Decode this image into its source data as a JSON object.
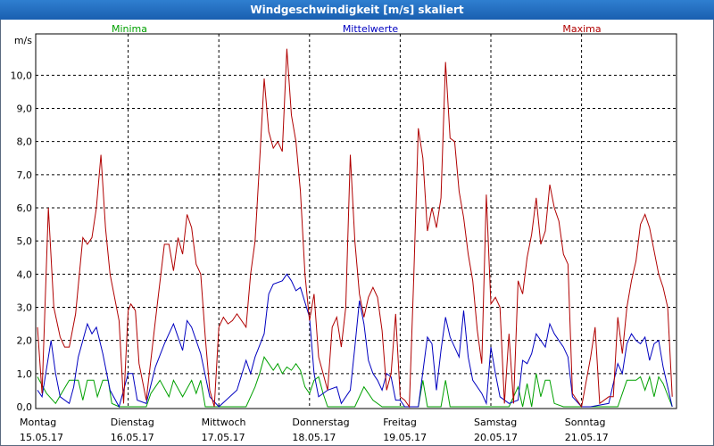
{
  "window": {
    "title": "Windgeschwindigkeit [m/s] skaliert"
  },
  "chart_data": {
    "type": "line",
    "title": "Windgeschwindigkeit [m/s] skaliert",
    "ylabel": "m/s",
    "ylim": [
      0,
      11.3
    ],
    "yticks": [
      "0,0",
      "1,0",
      "2,0",
      "3,0",
      "4,0",
      "5,0",
      "6,0",
      "7,0",
      "8,0",
      "9,0",
      "10,0"
    ],
    "grid": true,
    "legend_position": "top",
    "x_days": [
      {
        "day": "Montag",
        "date": "15.05.17"
      },
      {
        "day": "Dienstag",
        "date": "16.05.17"
      },
      {
        "day": "Mittwoch",
        "date": "17.05.17"
      },
      {
        "day": "Donnerstag",
        "date": "18.05.17"
      },
      {
        "day": "Freitag",
        "date": "19.05.17"
      },
      {
        "day": "Samstag",
        "date": "20.05.17"
      },
      {
        "day": "Sonntag",
        "date": "21.05.17"
      }
    ],
    "xlim_days": [
      0,
      7
    ],
    "series": [
      {
        "name": "Minima",
        "color": "#00a000",
        "points": [
          [
            0,
            0.9
          ],
          [
            0.1,
            0.4
          ],
          [
            0.2,
            0.1
          ],
          [
            0.35,
            0.8
          ],
          [
            0.45,
            0.8
          ],
          [
            0.5,
            0.2
          ],
          [
            0.55,
            0.8
          ],
          [
            0.62,
            0.8
          ],
          [
            0.66,
            0.3
          ],
          [
            0.72,
            0.8
          ],
          [
            0.78,
            0.8
          ],
          [
            0.82,
            0.1
          ],
          [
            0.9,
            0
          ],
          [
            1,
            0
          ],
          [
            1.2,
            0
          ],
          [
            1.25,
            0.4
          ],
          [
            1.35,
            0.8
          ],
          [
            1.45,
            0.3
          ],
          [
            1.5,
            0.8
          ],
          [
            1.6,
            0.3
          ],
          [
            1.7,
            0.8
          ],
          [
            1.75,
            0.4
          ],
          [
            1.8,
            0.8
          ],
          [
            1.85,
            0
          ],
          [
            2,
            0
          ],
          [
            2.3,
            0
          ],
          [
            2.4,
            0.6
          ],
          [
            2.45,
            1.0
          ],
          [
            2.5,
            1.5
          ],
          [
            2.55,
            1.3
          ],
          [
            2.6,
            1.1
          ],
          [
            2.65,
            1.3
          ],
          [
            2.7,
            1.0
          ],
          [
            2.75,
            1.2
          ],
          [
            2.8,
            1.1
          ],
          [
            2.85,
            1.3
          ],
          [
            2.9,
            1.1
          ],
          [
            2.95,
            0.6
          ],
          [
            3.0,
            0.4
          ],
          [
            3.05,
            0.8
          ],
          [
            3.1,
            0.9
          ],
          [
            3.15,
            0.4
          ],
          [
            3.2,
            0
          ],
          [
            3.3,
            0
          ],
          [
            3.5,
            0
          ],
          [
            3.6,
            0.6
          ],
          [
            3.7,
            0.2
          ],
          [
            3.8,
            0
          ],
          [
            4.0,
            0
          ],
          [
            4.2,
            0
          ],
          [
            4.25,
            0.8
          ],
          [
            4.3,
            0
          ],
          [
            4.45,
            0
          ],
          [
            4.5,
            0.8
          ],
          [
            4.55,
            0
          ],
          [
            4.7,
            0
          ],
          [
            5,
            0
          ],
          [
            5.2,
            0
          ],
          [
            5.3,
            0.6
          ],
          [
            5.35,
            0
          ],
          [
            5.4,
            0.7
          ],
          [
            5.45,
            0
          ],
          [
            5.5,
            1.0
          ],
          [
            5.55,
            0.3
          ],
          [
            5.6,
            0.8
          ],
          [
            5.65,
            0.8
          ],
          [
            5.7,
            0.1
          ],
          [
            5.8,
            0
          ],
          [
            6,
            0
          ],
          [
            6.4,
            0
          ],
          [
            6.5,
            0.8
          ],
          [
            6.55,
            0.8
          ],
          [
            6.6,
            0.8
          ],
          [
            6.65,
            0.9
          ],
          [
            6.7,
            0.5
          ],
          [
            6.75,
            0.9
          ],
          [
            6.8,
            0.3
          ],
          [
            6.85,
            0.9
          ],
          [
            6.9,
            0.7
          ],
          [
            7.0,
            0
          ]
        ]
      },
      {
        "name": "Mittelwerte",
        "color": "#0000c0",
        "points": [
          [
            0,
            0.5
          ],
          [
            0.05,
            0.3
          ],
          [
            0.15,
            2.0
          ],
          [
            0.2,
            1.0
          ],
          [
            0.25,
            0.3
          ],
          [
            0.35,
            0.1
          ],
          [
            0.4,
            0.6
          ],
          [
            0.45,
            1.5
          ],
          [
            0.5,
            2.0
          ],
          [
            0.55,
            2.5
          ],
          [
            0.6,
            2.2
          ],
          [
            0.65,
            2.4
          ],
          [
            0.72,
            1.6
          ],
          [
            0.8,
            0.5
          ],
          [
            0.9,
            0
          ],
          [
            1.0,
            1.0
          ],
          [
            1.05,
            1.0
          ],
          [
            1.1,
            0.2
          ],
          [
            1.2,
            0.1
          ],
          [
            1.3,
            1.2
          ],
          [
            1.4,
            1.9
          ],
          [
            1.5,
            2.5
          ],
          [
            1.55,
            2.1
          ],
          [
            1.6,
            1.7
          ],
          [
            1.65,
            2.6
          ],
          [
            1.7,
            2.4
          ],
          [
            1.8,
            1.6
          ],
          [
            1.9,
            0.3
          ],
          [
            2.0,
            0
          ],
          [
            2.2,
            0.5
          ],
          [
            2.3,
            1.4
          ],
          [
            2.35,
            1.0
          ],
          [
            2.4,
            1.5
          ],
          [
            2.5,
            2.2
          ],
          [
            2.55,
            3.4
          ],
          [
            2.6,
            3.7
          ],
          [
            2.7,
            3.8
          ],
          [
            2.75,
            4.0
          ],
          [
            2.8,
            3.8
          ],
          [
            2.85,
            3.5
          ],
          [
            2.9,
            3.6
          ],
          [
            3.0,
            2.7
          ],
          [
            3.05,
            1.0
          ],
          [
            3.1,
            0.3
          ],
          [
            3.2,
            0.5
          ],
          [
            3.3,
            0.6
          ],
          [
            3.35,
            0.1
          ],
          [
            3.45,
            0.5
          ],
          [
            3.5,
            1.8
          ],
          [
            3.55,
            3.2
          ],
          [
            3.6,
            2.5
          ],
          [
            3.65,
            1.4
          ],
          [
            3.7,
            1.0
          ],
          [
            3.75,
            0.8
          ],
          [
            3.8,
            0.5
          ],
          [
            3.85,
            1.0
          ],
          [
            3.9,
            0.9
          ],
          [
            3.95,
            0.2
          ],
          [
            4.0,
            0.2
          ],
          [
            4.05,
            0
          ],
          [
            4.2,
            0
          ],
          [
            4.3,
            2.1
          ],
          [
            4.35,
            1.9
          ],
          [
            4.4,
            0.5
          ],
          [
            4.45,
            1.7
          ],
          [
            4.5,
            2.7
          ],
          [
            4.55,
            2.1
          ],
          [
            4.65,
            1.5
          ],
          [
            4.7,
            2.9
          ],
          [
            4.75,
            1.5
          ],
          [
            4.8,
            0.8
          ],
          [
            4.9,
            0.4
          ],
          [
            4.95,
            0.1
          ],
          [
            5.0,
            1.8
          ],
          [
            5.05,
            1.0
          ],
          [
            5.1,
            0.3
          ],
          [
            5.2,
            0.1
          ],
          [
            5.3,
            0.2
          ],
          [
            5.35,
            1.4
          ],
          [
            5.4,
            1.3
          ],
          [
            5.45,
            1.6
          ],
          [
            5.5,
            2.2
          ],
          [
            5.6,
            1.8
          ],
          [
            5.65,
            2.5
          ],
          [
            5.7,
            2.2
          ],
          [
            5.75,
            2.0
          ],
          [
            5.8,
            1.8
          ],
          [
            5.85,
            1.5
          ],
          [
            5.9,
            0.3
          ],
          [
            6.0,
            0
          ],
          [
            6.1,
            0
          ],
          [
            6.3,
            0.1
          ],
          [
            6.4,
            1.3
          ],
          [
            6.45,
            1.0
          ],
          [
            6.5,
            1.9
          ],
          [
            6.55,
            2.2
          ],
          [
            6.6,
            2.0
          ],
          [
            6.65,
            1.9
          ],
          [
            6.7,
            2.1
          ],
          [
            6.75,
            1.4
          ],
          [
            6.8,
            1.9
          ],
          [
            6.85,
            2.0
          ],
          [
            6.9,
            1.2
          ],
          [
            7.0,
            0
          ]
        ]
      },
      {
        "name": "Maxima",
        "color": "#b00000",
        "points": [
          [
            0,
            2.4
          ],
          [
            0.05,
            0.4
          ],
          [
            0.12,
            6.0
          ],
          [
            0.18,
            3.0
          ],
          [
            0.25,
            2.1
          ],
          [
            0.3,
            1.8
          ],
          [
            0.35,
            1.8
          ],
          [
            0.42,
            2.8
          ],
          [
            0.5,
            5.1
          ],
          [
            0.55,
            4.9
          ],
          [
            0.6,
            5.1
          ],
          [
            0.65,
            6.0
          ],
          [
            0.7,
            7.6
          ],
          [
            0.75,
            5.4
          ],
          [
            0.8,
            4.0
          ],
          [
            0.9,
            2.6
          ],
          [
            0.95,
            0.1
          ],
          [
            1.0,
            2.9
          ],
          [
            1.03,
            3.1
          ],
          [
            1.08,
            2.9
          ],
          [
            1.12,
            1.3
          ],
          [
            1.2,
            0.2
          ],
          [
            1.3,
            2.6
          ],
          [
            1.4,
            4.9
          ],
          [
            1.45,
            4.9
          ],
          [
            1.5,
            4.1
          ],
          [
            1.55,
            5.1
          ],
          [
            1.6,
            4.6
          ],
          [
            1.65,
            5.8
          ],
          [
            1.7,
            5.4
          ],
          [
            1.75,
            4.3
          ],
          [
            1.8,
            4.0
          ],
          [
            1.85,
            2.1
          ],
          [
            1.9,
            0.5
          ],
          [
            1.95,
            0
          ],
          [
            2.0,
            2.4
          ],
          [
            2.05,
            2.7
          ],
          [
            2.1,
            2.5
          ],
          [
            2.15,
            2.6
          ],
          [
            2.2,
            2.8
          ],
          [
            2.3,
            2.4
          ],
          [
            2.35,
            4.0
          ],
          [
            2.4,
            5.0
          ],
          [
            2.45,
            7.4
          ],
          [
            2.5,
            9.9
          ],
          [
            2.55,
            8.3
          ],
          [
            2.6,
            7.8
          ],
          [
            2.65,
            8.0
          ],
          [
            2.7,
            7.7
          ],
          [
            2.75,
            10.8
          ],
          [
            2.8,
            8.8
          ],
          [
            2.85,
            8.0
          ],
          [
            2.9,
            6.5
          ],
          [
            2.95,
            4.0
          ],
          [
            3.0,
            2.6
          ],
          [
            3.05,
            3.4
          ],
          [
            3.1,
            1.5
          ],
          [
            3.15,
            1.0
          ],
          [
            3.2,
            0.5
          ],
          [
            3.25,
            2.4
          ],
          [
            3.3,
            2.7
          ],
          [
            3.35,
            1.8
          ],
          [
            3.4,
            3.0
          ],
          [
            3.45,
            7.6
          ],
          [
            3.5,
            5.0
          ],
          [
            3.55,
            3.4
          ],
          [
            3.6,
            2.7
          ],
          [
            3.65,
            3.3
          ],
          [
            3.7,
            3.6
          ],
          [
            3.75,
            3.3
          ],
          [
            3.8,
            2.3
          ],
          [
            3.85,
            0.5
          ],
          [
            3.9,
            1.0
          ],
          [
            3.95,
            2.8
          ],
          [
            4.0,
            0.3
          ],
          [
            4.05,
            0.2
          ],
          [
            4.1,
            0
          ],
          [
            4.15,
            3.9
          ],
          [
            4.2,
            8.4
          ],
          [
            4.25,
            7.5
          ],
          [
            4.3,
            5.3
          ],
          [
            4.35,
            6.0
          ],
          [
            4.4,
            5.4
          ],
          [
            4.45,
            6.3
          ],
          [
            4.5,
            10.4
          ],
          [
            4.55,
            8.1
          ],
          [
            4.6,
            8.0
          ],
          [
            4.65,
            6.5
          ],
          [
            4.7,
            5.7
          ],
          [
            4.75,
            4.6
          ],
          [
            4.8,
            3.8
          ],
          [
            4.85,
            2.3
          ],
          [
            4.9,
            1.3
          ],
          [
            4.95,
            6.4
          ],
          [
            5.0,
            3.1
          ],
          [
            5.05,
            3.3
          ],
          [
            5.1,
            3.0
          ],
          [
            5.15,
            0.1
          ],
          [
            5.2,
            2.2
          ],
          [
            5.25,
            0.1
          ],
          [
            5.3,
            3.8
          ],
          [
            5.35,
            3.4
          ],
          [
            5.4,
            4.5
          ],
          [
            5.45,
            5.2
          ],
          [
            5.5,
            6.3
          ],
          [
            5.55,
            4.9
          ],
          [
            5.6,
            5.3
          ],
          [
            5.65,
            6.7
          ],
          [
            5.7,
            6.0
          ],
          [
            5.75,
            5.6
          ],
          [
            5.8,
            4.6
          ],
          [
            5.85,
            4.3
          ],
          [
            5.9,
            0.4
          ],
          [
            6.0,
            0
          ],
          [
            6.1,
            1.5
          ],
          [
            6.15,
            2.4
          ],
          [
            6.2,
            0.1
          ],
          [
            6.3,
            0.3
          ],
          [
            6.35,
            0.3
          ],
          [
            6.4,
            2.7
          ],
          [
            6.45,
            1.6
          ],
          [
            6.5,
            3.0
          ],
          [
            6.55,
            3.8
          ],
          [
            6.6,
            4.4
          ],
          [
            6.65,
            5.5
          ],
          [
            6.7,
            5.8
          ],
          [
            6.75,
            5.4
          ],
          [
            6.8,
            4.7
          ],
          [
            6.85,
            4.0
          ],
          [
            6.9,
            3.6
          ],
          [
            6.95,
            3.0
          ],
          [
            7.0,
            0.3
          ]
        ]
      }
    ]
  }
}
